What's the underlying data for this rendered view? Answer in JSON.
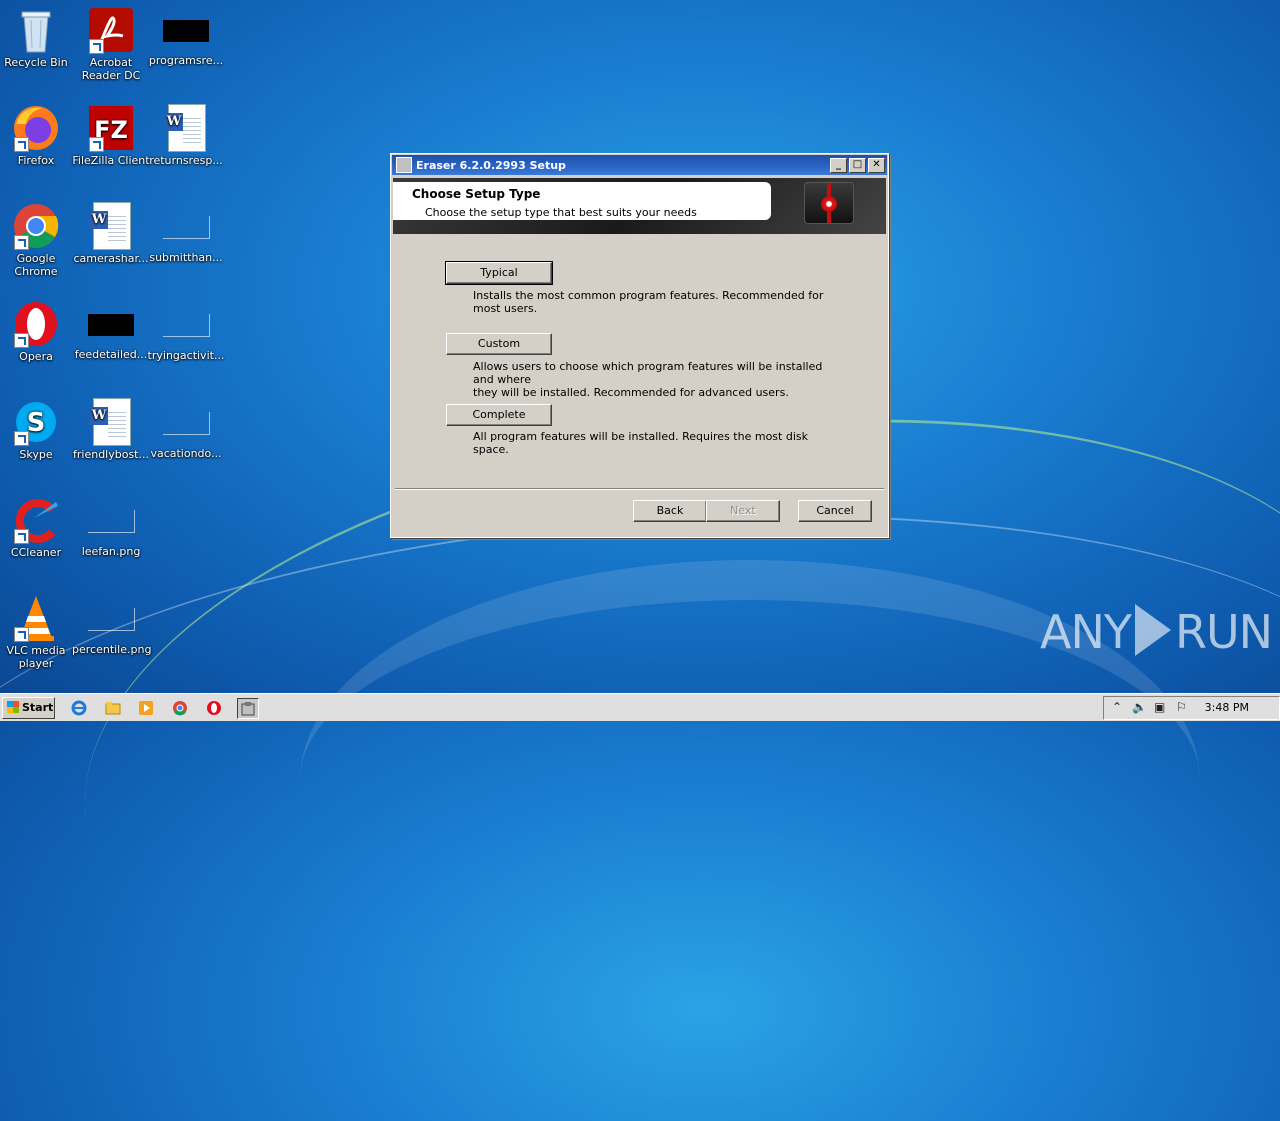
{
  "desktop": {
    "icons": [
      {
        "label": "Recycle Bin"
      },
      {
        "label": "Acrobat Reader DC"
      },
      {
        "label": "programsre..."
      },
      {
        "label": "Firefox"
      },
      {
        "label": "FileZilla Client"
      },
      {
        "label": "returnsresp..."
      },
      {
        "label": "Google Chrome"
      },
      {
        "label": "camerashar..."
      },
      {
        "label": "submitthan..."
      },
      {
        "label": "Opera"
      },
      {
        "label": "feedetailed..."
      },
      {
        "label": "tryingactivit..."
      },
      {
        "label": "Skype"
      },
      {
        "label": "friendlybost..."
      },
      {
        "label": "vacationdo..."
      },
      {
        "label": "CCleaner"
      },
      {
        "label": "leefan.png"
      },
      {
        "label": "VLC media player"
      },
      {
        "label": "percentile.png"
      }
    ]
  },
  "dialog": {
    "title": "Eraser 6.2.0.2993 Setup",
    "banner_title": "Choose Setup Type",
    "banner_subtitle": "Choose the setup type that best suits your needs",
    "options": [
      {
        "label": "Typical",
        "description": "Installs the most common program features. Recommended for most users."
      },
      {
        "label": "Custom",
        "description_line1": "Allows users to choose which program features will be installed and where",
        "description_line2": "they will be installed. Recommended for advanced users."
      },
      {
        "label": "Complete",
        "description": "All program features will be installed. Requires the most disk space."
      }
    ],
    "back_label": "Back",
    "next_label": "Next",
    "cancel_label": "Cancel"
  },
  "taskbar": {
    "start_label": "Start",
    "clock": "3:48 PM"
  },
  "watermark": {
    "left": "ANY",
    "right": "RUN"
  }
}
